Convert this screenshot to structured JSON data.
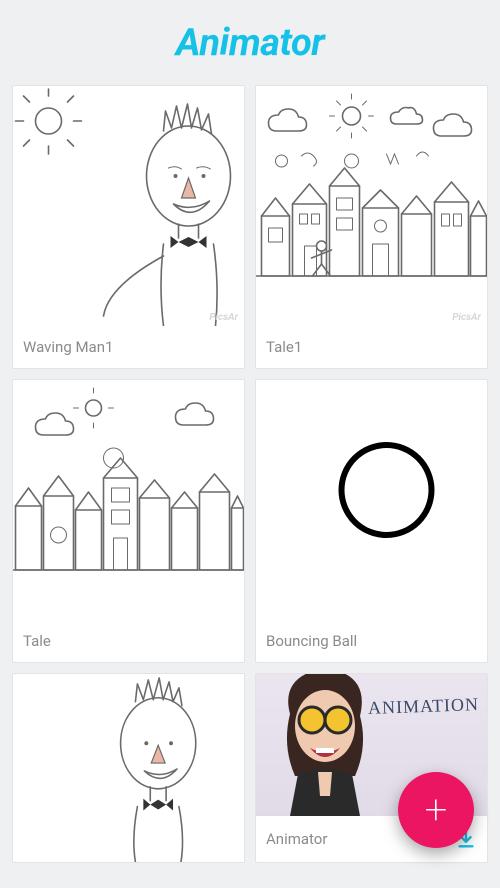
{
  "header": {
    "title": "Animator"
  },
  "watermark": "PicsAr",
  "items": [
    {
      "label": "Waving Man1",
      "watermark": true
    },
    {
      "label": "Tale1",
      "watermark": true
    },
    {
      "label": "Tale",
      "watermark": false
    },
    {
      "label": "Bouncing Ball",
      "watermark": false
    },
    {
      "label": "",
      "watermark": false
    },
    {
      "label": "Animator",
      "watermark": false,
      "download": true,
      "handText": "ANIMATION"
    }
  ],
  "fab": {
    "glyph": "+"
  }
}
